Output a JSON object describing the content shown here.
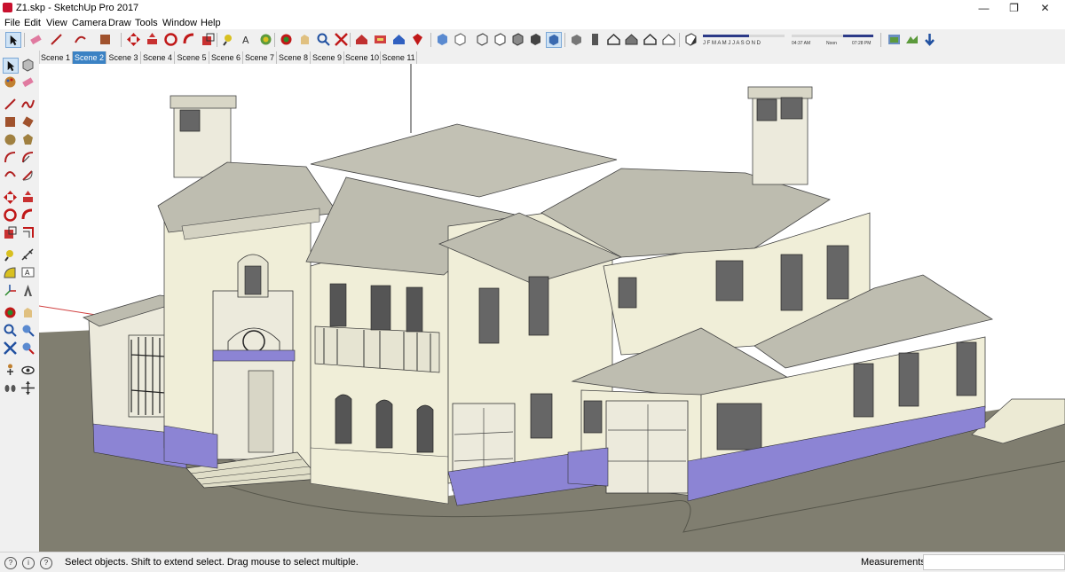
{
  "window": {
    "title": "Z1.skp - SketchUp Pro 2017"
  },
  "menu": [
    "File",
    "Edit",
    "View",
    "Camera",
    "Draw",
    "Tools",
    "Window",
    "Help"
  ],
  "shadow": {
    "months": "J F M A M J J A S O N D",
    "time_start": "04:37 AM",
    "time_noon": "Noon",
    "time_end": "07:28 PM"
  },
  "scenes": {
    "tabs": [
      "Scene 1",
      "Scene 2",
      "Scene 3",
      "Scene 4",
      "Scene 5",
      "Scene 6",
      "Scene 7",
      "Scene 8",
      "Scene 9",
      "Scene 10",
      "Scene 11"
    ],
    "active": "Scene 2"
  },
  "status": {
    "message": "Select objects. Shift to extend select. Drag mouse to select multiple.",
    "measurements_label": "Measurements",
    "measurements_value": ""
  },
  "colors": {
    "accent": "#3b82c4",
    "ground": "#807e70",
    "wall": "#f0eed8",
    "roof": "#bebdb0",
    "base": "#8c84d4"
  },
  "icons": {
    "toolbar": [
      "select-icon",
      "eraser-icon",
      "line-icon",
      "shape-icon",
      "paint-icon",
      "push-pull-icon",
      "follow-me-icon",
      "rotate-icon",
      "scale-icon",
      "offset-icon",
      "tape-icon",
      "text-icon",
      "dimension-icon",
      "orbit-icon",
      "pan-icon",
      "zoom-icon",
      "zoom-extents-icon",
      "warehouse-icon",
      "extension-icon",
      "ruby-icon",
      "xray-icon",
      "back-edges-icon",
      "wireframe-icon",
      "hidden-line-icon",
      "shaded-icon",
      "textured-icon",
      "monochrome-icon",
      "iso-view-icon",
      "top-view-icon",
      "front-view-icon",
      "right-view-icon",
      "back-view-icon",
      "left-view-icon",
      "shadows-icon",
      "sandbox-icon",
      "terrain-icon",
      "drape-icon"
    ],
    "left": [
      "select-icon",
      "component-icon",
      "paint-icon",
      "eraser-icon",
      "line-icon",
      "freehand-icon",
      "rectangle-icon",
      "rotated-rect-icon",
      "circle-icon",
      "polygon-icon",
      "arc-icon",
      "pie-icon",
      "move-icon",
      "push-pull-icon",
      "rotate-icon",
      "follow-me-icon",
      "scale-icon",
      "offset-icon",
      "tape-icon",
      "dimension-icon",
      "protractor-icon",
      "text-icon",
      "axes-icon",
      "3d-text-icon",
      "orbit-icon",
      "pan-icon",
      "zoom-icon",
      "zoom-window-icon",
      "zoom-extents-icon",
      "previous-icon",
      "position-camera-icon",
      "look-around-icon",
      "walk-icon",
      "section-icon"
    ]
  }
}
